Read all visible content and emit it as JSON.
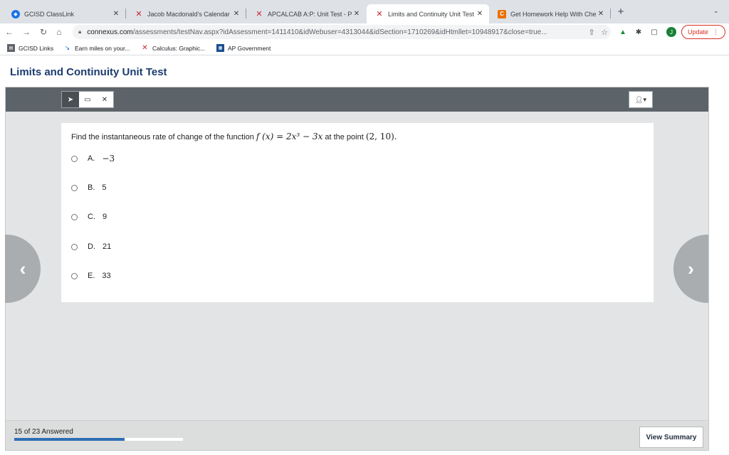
{
  "browser": {
    "tabs": [
      {
        "title": "GCISD ClassLink",
        "icon": "globe-icon"
      },
      {
        "title": "Jacob Macdonald's Calendar",
        "icon": "connexus-icon"
      },
      {
        "title": "APCALCAB A:P: Unit Test - Pa",
        "icon": "connexus-icon"
      },
      {
        "title": "Limits and Continuity Unit Test",
        "icon": "connexus-icon",
        "active": true
      },
      {
        "title": "Get Homework Help With Che",
        "icon": "chegg-icon"
      }
    ],
    "close_glyph": "✕",
    "new_tab_glyph": "+",
    "url_host": "connexus.com",
    "url_rest": "/assessments/testNav.aspx?idAssessment=1411410&idWebuser=4313044&idSection=1710269&idHtmllet=10948917&close=true...",
    "profile_initial": "J",
    "update_label": "Update",
    "bookmarks": [
      {
        "label": "GCISD Links",
        "icon": "news-icon"
      },
      {
        "label": "Earn miles on your...",
        "icon": "flag-icon"
      },
      {
        "label": "Calculus: Graphic...",
        "icon": "connexus-icon"
      },
      {
        "label": "AP Government",
        "icon": "gov-icon"
      }
    ]
  },
  "page": {
    "title": "Limits and Continuity Unit Test"
  },
  "question": {
    "prefix": "Find the instantaneous rate of change of the function",
    "function_html": "f (x) = 2x³ − 3x",
    "middle": "at the point",
    "point": "(2, 10).",
    "choices": [
      {
        "letter": "A.",
        "value": "−3"
      },
      {
        "letter": "B.",
        "value": "5"
      },
      {
        "letter": "C.",
        "value": "9"
      },
      {
        "letter": "D.",
        "value": "21"
      },
      {
        "letter": "E.",
        "value": "33"
      }
    ]
  },
  "footer": {
    "progress_text": "15 of 23 Answered",
    "answered": 15,
    "total": 23,
    "summary_label": "View Summary"
  },
  "colors": {
    "title": "#1b3c6f",
    "progress": "#2f6fb4",
    "topbar": "#5d6469"
  }
}
